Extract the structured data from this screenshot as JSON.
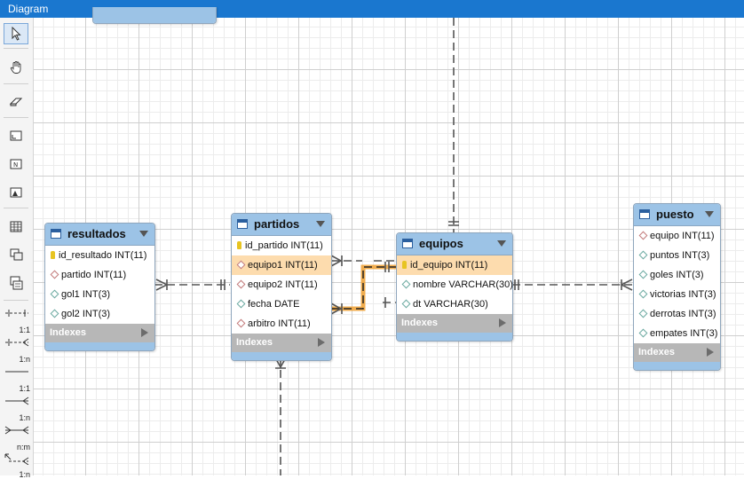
{
  "window": {
    "title": "Diagram"
  },
  "toolbar": {
    "tools": [
      {
        "name": "pointer-icon"
      },
      {
        "name": "hand-icon"
      },
      {
        "name": "eraser-icon"
      },
      {
        "name": "layer-icon"
      },
      {
        "name": "note-icon"
      },
      {
        "name": "image-icon"
      },
      {
        "name": "table-icon"
      },
      {
        "name": "view-icon"
      },
      {
        "name": "routine-icon"
      }
    ],
    "relationships": [
      {
        "label": "1:1"
      },
      {
        "label": "1:n"
      },
      {
        "label": "1:1"
      },
      {
        "label": "1:n"
      },
      {
        "label": "n:m"
      },
      {
        "label": "1:n"
      }
    ]
  },
  "tables": {
    "resultados": {
      "name": "resultados",
      "columns": [
        {
          "text": "id_resultado INT(11)",
          "kind": "pk"
        },
        {
          "text": "partido INT(11)",
          "kind": "fk"
        },
        {
          "text": "gol1 INT(3)",
          "kind": "col"
        },
        {
          "text": "gol2 INT(3)",
          "kind": "col"
        }
      ],
      "indexes_label": "Indexes"
    },
    "partidos": {
      "name": "partidos",
      "columns": [
        {
          "text": "id_partido INT(11)",
          "kind": "pk"
        },
        {
          "text": "equipo1 INT(11)",
          "kind": "fk"
        },
        {
          "text": "equipo2 INT(11)",
          "kind": "fk"
        },
        {
          "text": "fecha DATE",
          "kind": "col"
        },
        {
          "text": "arbitro INT(11)",
          "kind": "fk"
        }
      ],
      "indexes_label": "Indexes"
    },
    "equipos": {
      "name": "equipos",
      "columns": [
        {
          "text": "id_equipo INT(11)",
          "kind": "pk"
        },
        {
          "text": "nombre VARCHAR(30)",
          "kind": "col"
        },
        {
          "text": "dt VARCHAR(30)",
          "kind": "col"
        }
      ],
      "indexes_label": "Indexes"
    },
    "puesto": {
      "name": "puesto",
      "columns": [
        {
          "text": "equipo INT(11)",
          "kind": "fk"
        },
        {
          "text": "puntos INT(3)",
          "kind": "col"
        },
        {
          "text": "goles INT(3)",
          "kind": "col"
        },
        {
          "text": "victorias INT(3)",
          "kind": "col"
        },
        {
          "text": "derrotas INT(3)",
          "kind": "col"
        },
        {
          "text": "empates INT(3)",
          "kind": "col"
        }
      ],
      "indexes_label": "Indexes"
    }
  },
  "colors": {
    "titlebar": "#1a77cf",
    "table_header": "#9cc3e6",
    "highlight": "#fddcae",
    "selected_relation": "#f0a030",
    "indexes_bar": "#b7b7b7"
  }
}
